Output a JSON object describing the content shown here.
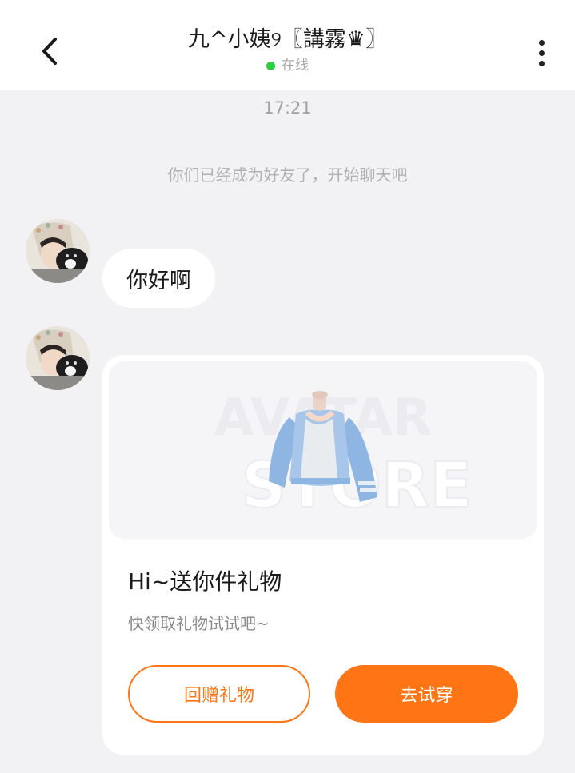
{
  "header": {
    "title": "九^小姨୨〖講霧♛〗",
    "status": "在线",
    "status_color": "#2ecc40"
  },
  "chat": {
    "timestamp": "17:21",
    "system_message": "你们已经成为好友了，开始聊天吧",
    "messages": [
      {
        "type": "text",
        "text": "你好啊"
      },
      {
        "type": "gift_card",
        "watermark_line1": "AVATAR",
        "watermark_line2": "STORE",
        "title": "Hi~送你件礼物",
        "subtitle": "快领取礼物试试吧~",
        "secondary_button": "回赠礼物",
        "primary_button": "去试穿"
      }
    ]
  },
  "theme": {
    "accent": "#ff7414",
    "background": "#f2f2f4"
  }
}
